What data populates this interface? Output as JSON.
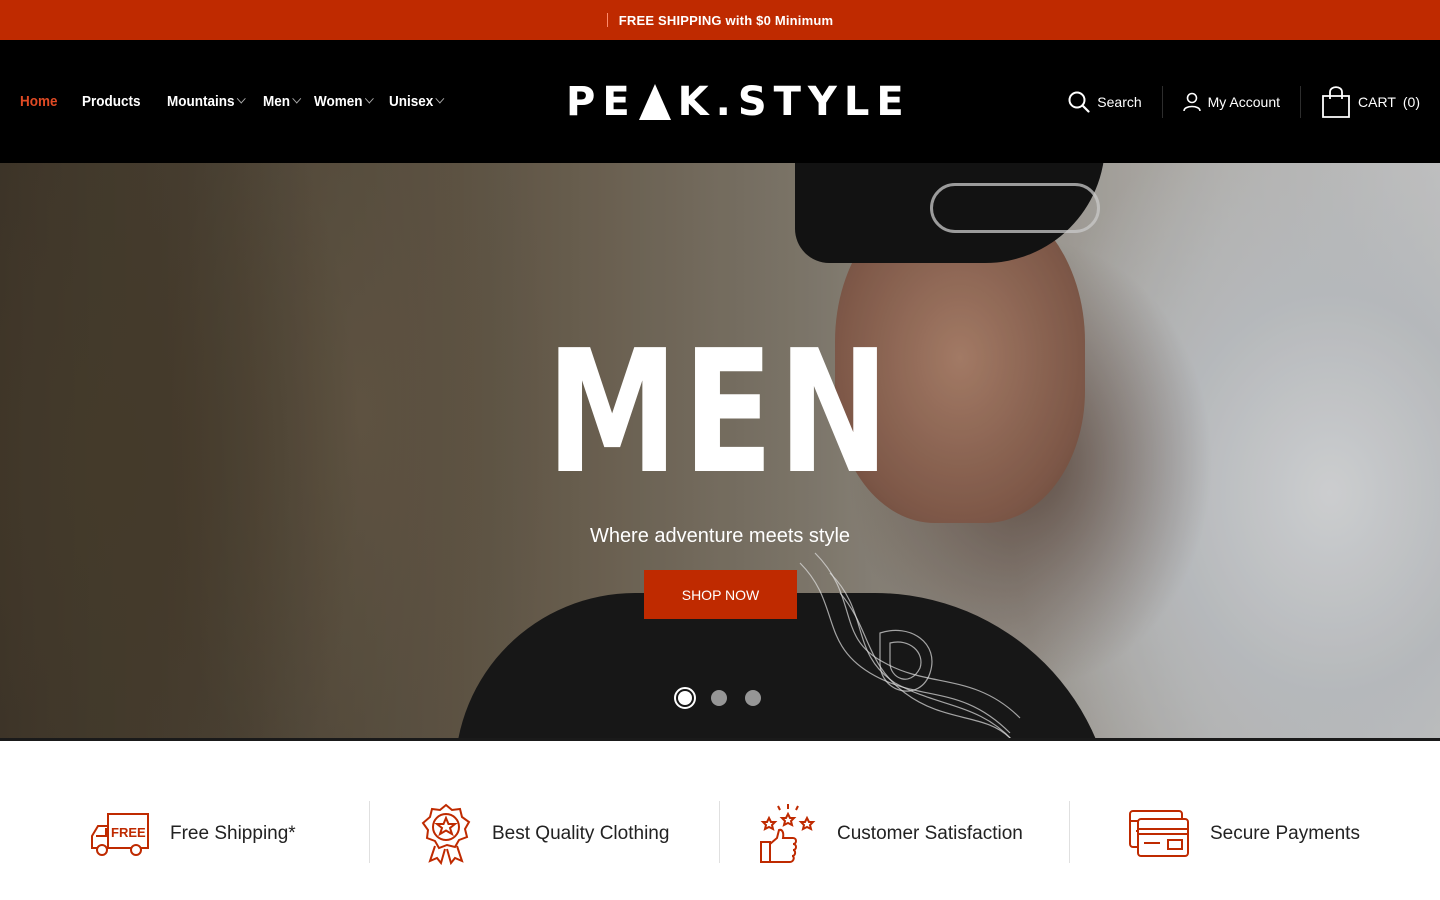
{
  "announcement": {
    "text": "FREE SHIPPING with $0 Minimum"
  },
  "header": {
    "nav": [
      {
        "label": "Home",
        "active": true,
        "has_dropdown": false
      },
      {
        "label": "Products",
        "active": false,
        "has_dropdown": false
      },
      {
        "label": "Mountains",
        "active": false,
        "has_dropdown": true
      },
      {
        "label": "Men",
        "active": false,
        "has_dropdown": true
      },
      {
        "label": "Women",
        "active": false,
        "has_dropdown": true
      },
      {
        "label": "Unisex",
        "active": false,
        "has_dropdown": true
      }
    ],
    "logo": {
      "left": "PE",
      "right": "K.STYLE"
    },
    "search_label": "Search",
    "account_label": "My Account",
    "cart_label": "CART",
    "cart_count": "(0)"
  },
  "hero": {
    "title": "MEN",
    "subtitle": "Where adventure meets style",
    "cta_label": "SHOP NOW",
    "slides": 3,
    "active_slide": 1
  },
  "features": [
    {
      "label": "Free Shipping*",
      "icon": "free-shipping-truck-icon"
    },
    {
      "label": "Best Quality Clothing",
      "icon": "quality-badge-icon"
    },
    {
      "label": "Customer Satisfaction",
      "icon": "thumbs-up-stars-icon"
    },
    {
      "label": "Secure Payments",
      "icon": "credit-card-icon"
    }
  ],
  "colors": {
    "accent": "#bf2a00",
    "nav_active": "#e04a24",
    "header_bg": "#000000"
  }
}
